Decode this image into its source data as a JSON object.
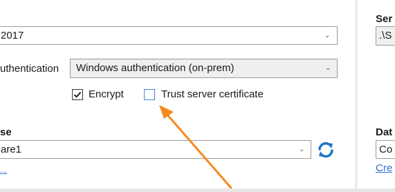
{
  "server_version": {
    "value": "2017"
  },
  "authentication": {
    "label": "uthentication",
    "value": "Windows authentication (on-prem)"
  },
  "options": {
    "encrypt": {
      "label": "Encrypt",
      "checked": true
    },
    "trust_cert": {
      "label": "Trust server certificate",
      "checked": false
    }
  },
  "database": {
    "label": "se",
    "value": "are1",
    "link": "..."
  },
  "right_panel": {
    "server_label": "Ser",
    "server_value": ".\\S",
    "database_label": "Dat",
    "database_value": "Co",
    "create_link": "Cre"
  },
  "colors": {
    "arrow": "#f5891f",
    "refresh": "#1a73c8",
    "link": "#2f6fd1"
  }
}
